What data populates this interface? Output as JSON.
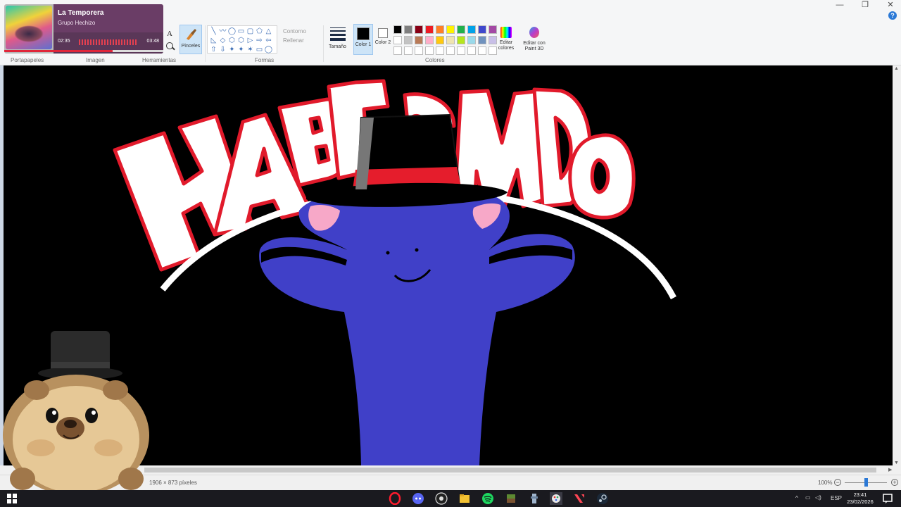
{
  "window": {
    "minimize": "—",
    "maximize": "❐",
    "close": "✕",
    "help": "?"
  },
  "ribbon": {
    "groups": {
      "clipboard": "Portapapeles",
      "image": "Imagen",
      "tools": "Herramientas",
      "shapes": "Formas",
      "colors": "Colores"
    },
    "brushes_label": "Pinceles",
    "text_tool": "A",
    "outline_label": "Contorno",
    "fill_label": "Rellenar",
    "size_label": "Tamaño",
    "color1_label": "Color 1",
    "color2_label": "Color 2",
    "color1_value": "#000000",
    "color2_value": "#ffffff",
    "edit_colors_label": "Editar colores",
    "paint3d_label": "Editar con Paint 3D",
    "palette": [
      "#000000",
      "#7f7f7f",
      "#880015",
      "#ed1c24",
      "#ff7f27",
      "#fff200",
      "#22b14c",
      "#00a2e8",
      "#3f48cc",
      "#a349a4",
      "#ffffff",
      "#c3c3c3",
      "#b97a57",
      "#ffaec9",
      "#ffc90e",
      "#efe4b0",
      "#b5e61d",
      "#99d9ea",
      "#7092be",
      "#c8bfe7",
      "#ffffff",
      "#ffffff",
      "#ffffff",
      "#ffffff",
      "#ffffff",
      "#ffffff",
      "#ffffff",
      "#ffffff",
      "#ffffff",
      "#ffffff"
    ],
    "shapes_icons": [
      "╲",
      "〰",
      "◯",
      "▭",
      "▢",
      "⬠",
      "△",
      "◺",
      "◇",
      "⬡",
      "⬡",
      "▷",
      "⇨",
      "⇦",
      "⇧",
      "⇩",
      "✦",
      "✦",
      "✶",
      "▭",
      "◯"
    ]
  },
  "music_widget": {
    "title": "La Temporera",
    "artist": "Grupo Hechizo",
    "elapsed": "02:35",
    "duration": "03:48",
    "progress": 0.68
  },
  "canvas": {
    "background": "#000000",
    "artwork_text": "HABLANDO"
  },
  "status": {
    "dimensions": "1906 × 873 píxeles",
    "zoom": "100%",
    "zoom_minus": "−",
    "zoom_plus": "+"
  },
  "taskbar": {
    "time": "23:41",
    "date": "23/02/2026",
    "language": "ESP",
    "icons": [
      "windows-start-icon",
      "opera-icon",
      "discord-icon",
      "obs-icon",
      "file-explorer-icon",
      "spotify-icon",
      "minecraft-icon",
      "app-icon",
      "paint-icon",
      "valorant-icon",
      "steam-icon"
    ]
  }
}
